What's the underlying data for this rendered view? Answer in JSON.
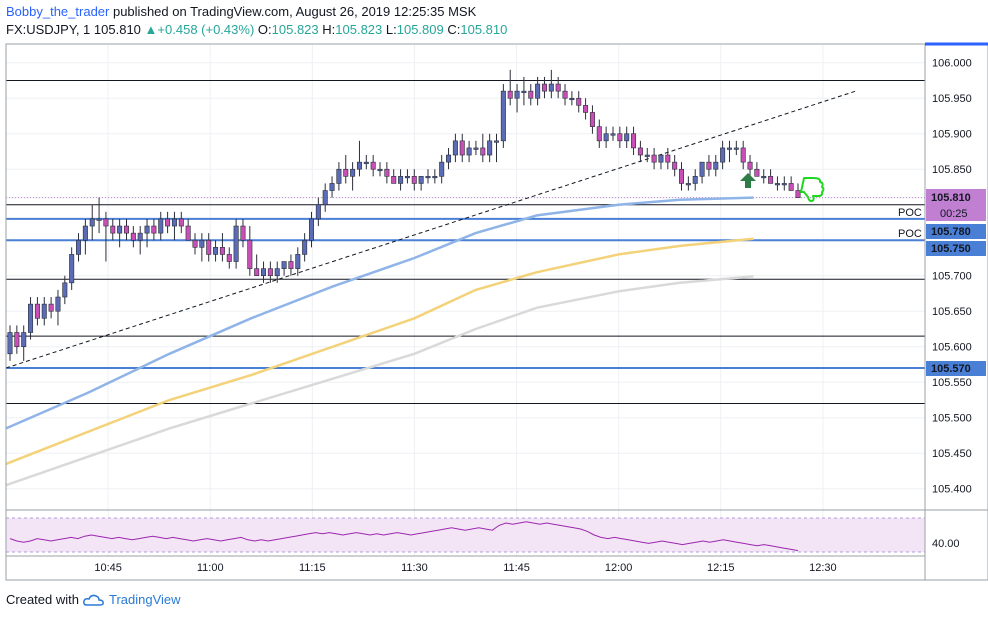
{
  "header": {
    "author": "Bobby_the_trader",
    "published": " published on TradingView.com, August 26, 2019 12:25:35 MSK",
    "symbol": "FX:USDJPY, 1",
    "last": "105.810",
    "change": "+0.458 (+0.43%)",
    "o_label": "O:",
    "o": "105.823",
    "h_label": "H:",
    "h": "105.823",
    "l_label": "L:",
    "l": "105.809",
    "c_label": "C:",
    "c": "105.810"
  },
  "footer": {
    "created_with": "Created with",
    "brand": "TradingView"
  },
  "colors": {
    "bull": "#5b6bb5",
    "bear": "#c84fb5",
    "wick": "#2a2e39",
    "sma_fast": "#8fb4e8",
    "sma_mid": "#f3d27a",
    "sma_slow": "#d9d9d9",
    "level_blue": "#4a7fd6",
    "level_black": "#131722",
    "rsi": "#9c27b0",
    "rsi_bg": "#f3e5f5",
    "price_tag": "#c07fd1",
    "arrow": "#2e7d46",
    "thumb": "#1ed91e"
  },
  "icons": {
    "up_arrow": "up-arrow-icon",
    "thumbs_down": "thumbs-down-icon",
    "logo": "cloud-logo-icon"
  },
  "chart_data": {
    "type": "candlestick",
    "x_ticks": [
      "10:45",
      "11:00",
      "11:15",
      "11:30",
      "11:45",
      "12:00",
      "12:15",
      "12:30"
    ],
    "y_ticks": [
      "106.000",
      "105.950",
      "105.900",
      "105.850",
      "105.810",
      "105.700",
      "105.650",
      "105.600",
      "105.550",
      "105.500",
      "105.450",
      "105.400"
    ],
    "ylim": [
      105.37,
      106.025
    ],
    "rsi_tick": "40.00",
    "tags": {
      "current": {
        "price": 105.81,
        "label": "105.810",
        "timer": "00:25"
      },
      "poc1": {
        "price": 105.78,
        "label": "105.780",
        "text": "POC"
      },
      "poc2": {
        "price": 105.75,
        "label": "105.750",
        "text": "POC"
      },
      "level3": {
        "price": 105.57,
        "label": "105.570"
      }
    },
    "blue_levels": [
      105.78,
      105.75,
      105.57
    ],
    "black_levels": [
      105.975,
      105.8,
      105.695,
      105.615,
      105.52
    ],
    "trendline": {
      "from": [
        10.5,
        105.57
      ],
      "to": [
        12.58,
        105.96
      ]
    },
    "moving_averages": [
      {
        "key": "sma_fast",
        "points": [
          [
            10.5,
            105.485
          ],
          [
            10.7,
            105.535
          ],
          [
            10.9,
            105.59
          ],
          [
            11.1,
            105.64
          ],
          [
            11.3,
            105.685
          ],
          [
            11.5,
            105.725
          ],
          [
            11.65,
            105.76
          ],
          [
            11.8,
            105.785
          ],
          [
            12.0,
            105.8
          ],
          [
            12.15,
            105.807
          ],
          [
            12.33,
            105.81
          ]
        ]
      },
      {
        "key": "sma_mid",
        "points": [
          [
            10.5,
            105.435
          ],
          [
            10.7,
            105.48
          ],
          [
            10.9,
            105.525
          ],
          [
            11.1,
            105.56
          ],
          [
            11.3,
            105.6
          ],
          [
            11.5,
            105.64
          ],
          [
            11.65,
            105.68
          ],
          [
            11.8,
            105.705
          ],
          [
            12.0,
            105.73
          ],
          [
            12.15,
            105.742
          ],
          [
            12.33,
            105.752
          ]
        ]
      },
      {
        "key": "sma_slow",
        "points": [
          [
            10.5,
            105.405
          ],
          [
            10.7,
            105.445
          ],
          [
            10.9,
            105.485
          ],
          [
            11.1,
            105.52
          ],
          [
            11.3,
            105.555
          ],
          [
            11.5,
            105.59
          ],
          [
            11.65,
            105.625
          ],
          [
            11.8,
            105.655
          ],
          [
            12.0,
            105.678
          ],
          [
            12.15,
            105.69
          ],
          [
            12.33,
            105.699
          ]
        ]
      }
    ],
    "candles_ohlc": [
      [
        105.59,
        105.63,
        105.58,
        105.62
      ],
      [
        105.62,
        105.63,
        105.59,
        105.6
      ],
      [
        105.6,
        105.63,
        105.58,
        105.62
      ],
      [
        105.62,
        105.67,
        105.61,
        105.66
      ],
      [
        105.66,
        105.67,
        105.63,
        105.64
      ],
      [
        105.64,
        105.67,
        105.63,
        105.66
      ],
      [
        105.66,
        105.67,
        105.64,
        105.65
      ],
      [
        105.65,
        105.68,
        105.63,
        105.67
      ],
      [
        105.67,
        105.7,
        105.66,
        105.69
      ],
      [
        105.69,
        105.74,
        105.68,
        105.73
      ],
      [
        105.73,
        105.76,
        105.72,
        105.75
      ],
      [
        105.75,
        105.78,
        105.73,
        105.77
      ],
      [
        105.77,
        105.8,
        105.75,
        105.78
      ],
      [
        105.78,
        105.81,
        105.76,
        105.78
      ],
      [
        105.78,
        105.79,
        105.72,
        105.77
      ],
      [
        105.77,
        105.78,
        105.75,
        105.76
      ],
      [
        105.76,
        105.78,
        105.74,
        105.77
      ],
      [
        105.77,
        105.78,
        105.75,
        105.76
      ],
      [
        105.76,
        105.77,
        105.74,
        105.75
      ],
      [
        105.75,
        105.77,
        105.73,
        105.76
      ],
      [
        105.76,
        105.78,
        105.74,
        105.77
      ],
      [
        105.77,
        105.78,
        105.75,
        105.76
      ],
      [
        105.76,
        105.79,
        105.75,
        105.78
      ],
      [
        105.78,
        105.79,
        105.76,
        105.77
      ],
      [
        105.77,
        105.79,
        105.75,
        105.78
      ],
      [
        105.78,
        105.79,
        105.76,
        105.77
      ],
      [
        105.77,
        105.78,
        105.75,
        105.75
      ],
      [
        105.75,
        105.76,
        105.73,
        105.74
      ],
      [
        105.74,
        105.76,
        105.72,
        105.75
      ],
      [
        105.75,
        105.76,
        105.72,
        105.73
      ],
      [
        105.73,
        105.75,
        105.72,
        105.74
      ],
      [
        105.74,
        105.76,
        105.72,
        105.73
      ],
      [
        105.73,
        105.74,
        105.71,
        105.72
      ],
      [
        105.72,
        105.78,
        105.71,
        105.77
      ],
      [
        105.77,
        105.78,
        105.74,
        105.75
      ],
      [
        105.75,
        105.77,
        105.7,
        105.71
      ],
      [
        105.71,
        105.73,
        105.7,
        105.7
      ],
      [
        105.7,
        105.72,
        105.69,
        105.71
      ],
      [
        105.71,
        105.72,
        105.69,
        105.7
      ],
      [
        105.7,
        105.72,
        105.69,
        105.71
      ],
      [
        105.71,
        105.72,
        105.7,
        105.72
      ],
      [
        105.72,
        105.73,
        105.7,
        105.71
      ],
      [
        105.71,
        105.74,
        105.7,
        105.73
      ],
      [
        105.73,
        105.76,
        105.72,
        105.75
      ],
      [
        105.75,
        105.79,
        105.74,
        105.78
      ],
      [
        105.78,
        105.81,
        105.77,
        105.8
      ],
      [
        105.8,
        105.83,
        105.79,
        105.82
      ],
      [
        105.82,
        105.84,
        105.81,
        105.83
      ],
      [
        105.83,
        105.86,
        105.82,
        105.85
      ],
      [
        105.85,
        105.87,
        105.83,
        105.84
      ],
      [
        105.84,
        105.86,
        105.82,
        105.85
      ],
      [
        105.85,
        105.89,
        105.84,
        105.86
      ],
      [
        105.86,
        105.87,
        105.85,
        105.86
      ],
      [
        105.86,
        105.87,
        105.84,
        105.85
      ],
      [
        105.85,
        105.86,
        105.84,
        105.85
      ],
      [
        105.85,
        105.86,
        105.83,
        105.84
      ],
      [
        105.84,
        105.85,
        105.83,
        105.83
      ],
      [
        105.83,
        105.85,
        105.82,
        105.84
      ],
      [
        105.84,
        105.85,
        105.83,
        105.84
      ],
      [
        105.84,
        105.85,
        105.82,
        105.83
      ],
      [
        105.83,
        105.84,
        105.82,
        105.84
      ],
      [
        105.84,
        105.85,
        105.83,
        105.84
      ],
      [
        105.84,
        105.85,
        105.83,
        105.84
      ],
      [
        105.84,
        105.87,
        105.83,
        105.86
      ],
      [
        105.86,
        105.88,
        105.85,
        105.87
      ],
      [
        105.87,
        105.9,
        105.86,
        105.89
      ],
      [
        105.89,
        105.9,
        105.86,
        105.87
      ],
      [
        105.87,
        105.89,
        105.86,
        105.88
      ],
      [
        105.88,
        105.89,
        105.87,
        105.88
      ],
      [
        105.88,
        105.9,
        105.86,
        105.87
      ],
      [
        105.87,
        105.9,
        105.86,
        105.89
      ],
      [
        105.89,
        105.9,
        105.86,
        105.89
      ],
      [
        105.89,
        105.97,
        105.88,
        105.96
      ],
      [
        105.96,
        105.99,
        105.94,
        105.95
      ],
      [
        105.95,
        105.97,
        105.93,
        105.96
      ],
      [
        105.96,
        105.98,
        105.94,
        105.96
      ],
      [
        105.96,
        105.97,
        105.94,
        105.95
      ],
      [
        105.95,
        105.98,
        105.94,
        105.97
      ],
      [
        105.97,
        105.98,
        105.95,
        105.96
      ],
      [
        105.96,
        105.99,
        105.95,
        105.97
      ],
      [
        105.97,
        105.98,
        105.95,
        105.96
      ],
      [
        105.96,
        105.97,
        105.94,
        105.95
      ],
      [
        105.95,
        105.96,
        105.94,
        105.95
      ],
      [
        105.95,
        105.96,
        105.93,
        105.94
      ],
      [
        105.94,
        105.95,
        105.92,
        105.93
      ],
      [
        105.93,
        105.94,
        105.9,
        105.91
      ],
      [
        105.91,
        105.92,
        105.88,
        105.89
      ],
      [
        105.89,
        105.91,
        105.88,
        105.9
      ],
      [
        105.9,
        105.91,
        105.89,
        105.9
      ],
      [
        105.9,
        105.91,
        105.88,
        105.89
      ],
      [
        105.89,
        105.91,
        105.88,
        105.9
      ],
      [
        105.9,
        105.91,
        105.87,
        105.88
      ],
      [
        105.88,
        105.89,
        105.86,
        105.87
      ],
      [
        105.87,
        105.88,
        105.86,
        105.87
      ],
      [
        105.87,
        105.88,
        105.85,
        105.86
      ],
      [
        105.86,
        105.87,
        105.85,
        105.87
      ],
      [
        105.87,
        105.88,
        105.85,
        105.86
      ],
      [
        105.86,
        105.87,
        105.84,
        105.85
      ],
      [
        105.85,
        105.86,
        105.82,
        105.83
      ],
      [
        105.83,
        105.84,
        105.82,
        105.83
      ],
      [
        105.83,
        105.85,
        105.82,
        105.84
      ],
      [
        105.84,
        105.86,
        105.83,
        105.86
      ],
      [
        105.86,
        105.87,
        105.84,
        105.85
      ],
      [
        105.85,
        105.87,
        105.84,
        105.86
      ],
      [
        105.86,
        105.89,
        105.85,
        105.88
      ],
      [
        105.88,
        105.89,
        105.86,
        105.88
      ],
      [
        105.88,
        105.89,
        105.87,
        105.88
      ],
      [
        105.88,
        105.89,
        105.85,
        105.86
      ],
      [
        105.86,
        105.87,
        105.84,
        105.85
      ],
      [
        105.85,
        105.86,
        105.84,
        105.84
      ],
      [
        105.84,
        105.85,
        105.83,
        105.84
      ],
      [
        105.84,
        105.85,
        105.83,
        105.83
      ],
      [
        105.83,
        105.84,
        105.82,
        105.83
      ],
      [
        105.83,
        105.84,
        105.82,
        105.83
      ],
      [
        105.83,
        105.84,
        105.82,
        105.82
      ],
      [
        105.82,
        105.83,
        105.81,
        105.81
      ]
    ],
    "rsi_values": [
      47,
      45,
      44,
      45,
      47,
      46,
      45,
      46,
      47,
      48,
      47,
      49,
      50,
      49,
      48,
      47,
      48,
      47,
      46,
      47,
      48,
      49,
      48,
      47,
      48,
      47,
      46,
      45,
      46,
      47,
      46,
      45,
      46,
      47,
      48,
      46,
      45,
      46,
      45,
      46,
      47,
      48,
      49,
      50,
      51,
      52,
      51,
      52,
      51,
      50,
      51,
      52,
      51,
      50,
      51,
      50,
      51,
      52,
      51,
      50,
      51,
      52,
      53,
      54,
      55,
      56,
      55,
      54,
      55,
      56,
      55,
      54,
      58,
      60,
      59,
      60,
      61,
      60,
      59,
      60,
      59,
      58,
      57,
      56,
      55,
      53,
      50,
      48,
      47,
      48,
      47,
      46,
      45,
      44,
      43,
      44,
      45,
      44,
      43,
      42,
      43,
      44,
      45,
      44,
      45,
      46,
      45,
      44,
      43,
      42,
      41,
      42,
      41,
      40,
      39,
      38,
      37
    ]
  }
}
